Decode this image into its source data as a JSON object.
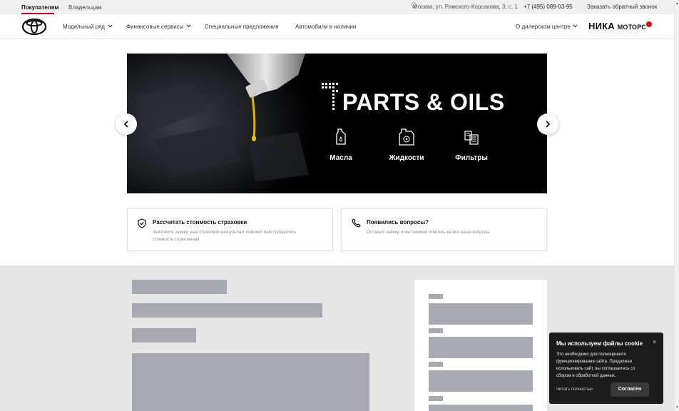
{
  "topbar": {
    "tabs": [
      "Покупателям",
      "Владельцам"
    ],
    "address": "Москва, ул. Римского-Корсакова, 3, с. 1",
    "phone": "+7 (495) 089-03-95",
    "callback": "Заказать обратный звонок"
  },
  "nav": {
    "items": [
      "Модельный ряд",
      "Финансовые сервисы",
      "Специальные предложения",
      "Автомобили в наличии"
    ],
    "about": "О дилерском центре",
    "brand_main": "НИКА",
    "brand_sub": "МОТОРС"
  },
  "hero": {
    "title": "PARTS & OILS",
    "categories": [
      {
        "label": "Масла",
        "icon": "oil-canister-icon"
      },
      {
        "label": "Жидкости",
        "icon": "fluid-canister-icon"
      },
      {
        "label": "Фильтры",
        "icon": "filter-icon"
      }
    ]
  },
  "cards": [
    {
      "title": "Рассчитать стоимость страховки",
      "desc": "Заполните заявку, наш страховой консультант поможет вам определить стоимость страхования",
      "icon": "shield-check-icon"
    },
    {
      "title": "Появились вопросы?",
      "desc": "Оставьте заявку, и мы сможем ответить на все ваши вопросы",
      "icon": "phone-icon"
    }
  ],
  "cookie": {
    "title": "Мы используем файлы cookie",
    "body": "Это необходимо для полноценного функционирования сайта. Продолжая использовать сайт, вы соглашаетесь со сбором и обработкой данных.",
    "read_more": "Читать полностью",
    "accept": "Согласен",
    "close": "×"
  },
  "colors": {
    "accent": "#d0021b",
    "skeleton": "#a9a9b2",
    "section_bg": "#e6e6e6"
  }
}
